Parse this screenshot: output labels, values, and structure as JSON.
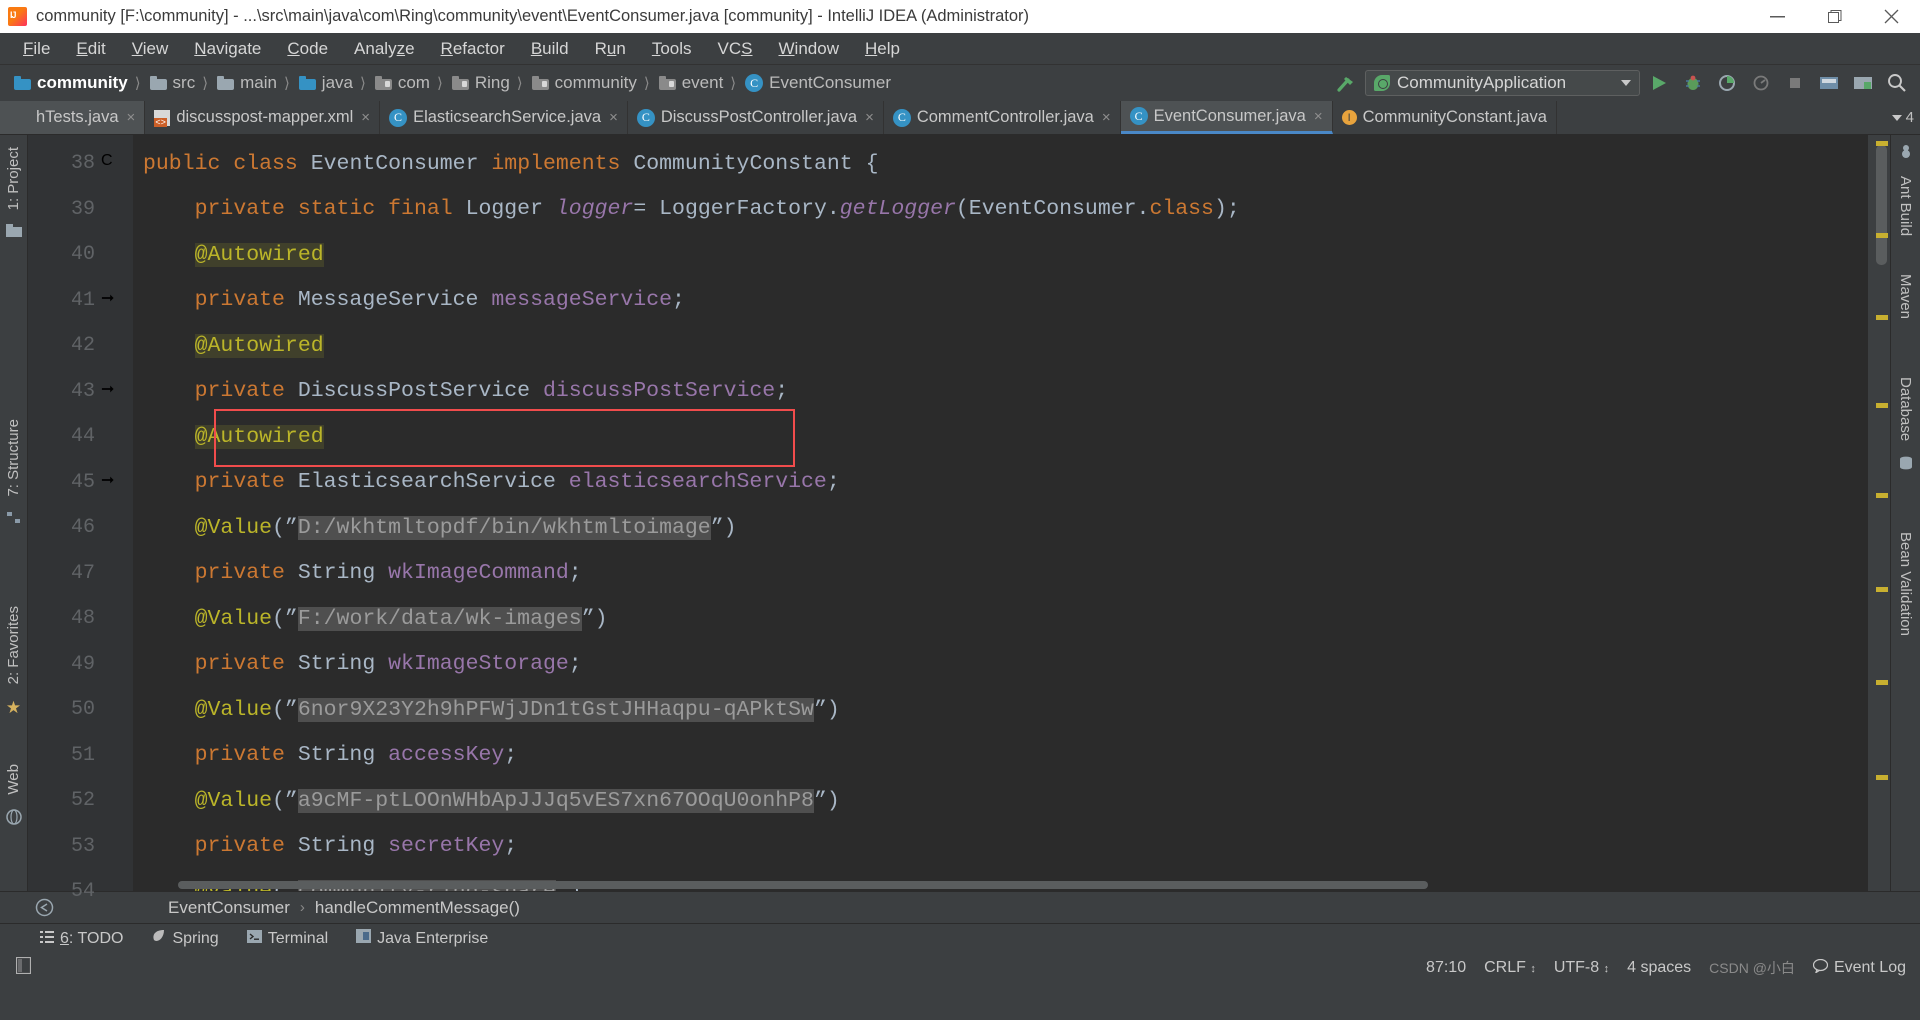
{
  "window": {
    "title": "community [F:\\community] - ...\\src\\main\\java\\com\\Ring\\community\\event\\EventConsumer.java [community] - IntelliJ IDEA (Administrator)",
    "logo_icon": "intellij-idea-logo-icon",
    "minimize_icon": "minimize-icon",
    "maximize_icon": "maximize-restore-icon",
    "close_icon": "close-icon"
  },
  "menu": [
    {
      "label": "File",
      "mnemonic": "F"
    },
    {
      "label": "Edit",
      "mnemonic": "E"
    },
    {
      "label": "View",
      "mnemonic": "V"
    },
    {
      "label": "Navigate",
      "mnemonic": "N"
    },
    {
      "label": "Code",
      "mnemonic": "C"
    },
    {
      "label": "Analyze",
      "mnemonic": "z"
    },
    {
      "label": "Refactor",
      "mnemonic": "R"
    },
    {
      "label": "Build",
      "mnemonic": "B"
    },
    {
      "label": "Run",
      "mnemonic": "u"
    },
    {
      "label": "Tools",
      "mnemonic": "T"
    },
    {
      "label": "VCS",
      "mnemonic": "S"
    },
    {
      "label": "Window",
      "mnemonic": "W"
    },
    {
      "label": "Help",
      "mnemonic": "H"
    }
  ],
  "breadcrumbs": [
    {
      "label": "community",
      "icon": "module-folder-icon"
    },
    {
      "label": "src",
      "icon": "folder-icon"
    },
    {
      "label": "main",
      "icon": "folder-icon"
    },
    {
      "label": "java",
      "icon": "source-root-folder-icon"
    },
    {
      "label": "com",
      "icon": "package-icon"
    },
    {
      "label": "Ring",
      "icon": "package-icon"
    },
    {
      "label": "community",
      "icon": "package-icon"
    },
    {
      "label": "event",
      "icon": "package-icon"
    },
    {
      "label": "EventConsumer",
      "icon": "java-class-icon"
    }
  ],
  "toolbar": {
    "run_config": "CommunityApplication",
    "run_config_icon": "spring-boot-leaf-icon",
    "dropdown_icon": "chevron-down-icon",
    "build_icon": "build-hammer-icon",
    "run_icon": "run-play-icon",
    "debug_icon": "debug-bug-icon",
    "run_with_coverage_icon": "run-coverage-icon",
    "profile_icon": "profiler-icon",
    "stop_icon": "stop-icon",
    "update_app_icon": "update-running-application-icon",
    "settings_icon": "settings-gear-icon",
    "search_icon": "search-everywhere-icon"
  },
  "tabs": [
    {
      "label": "hTests.java",
      "icon": "java-class-icon",
      "state": "partial",
      "close": "×"
    },
    {
      "label": "discusspost-mapper.xml",
      "icon": "xml-file-icon",
      "state": "normal",
      "close": "×"
    },
    {
      "label": "ElasticsearchService.java",
      "icon": "java-class-icon",
      "state": "normal",
      "close": "×"
    },
    {
      "label": "DiscussPostController.java",
      "icon": "java-class-icon",
      "state": "normal",
      "close": "×"
    },
    {
      "label": "CommentController.java",
      "icon": "java-class-icon",
      "state": "normal",
      "close": "×"
    },
    {
      "label": "EventConsumer.java",
      "icon": "java-class-icon",
      "state": "active",
      "close": "×"
    },
    {
      "label": "CommunityConstant.java",
      "icon": "java-interface-icon",
      "state": "normal",
      "close": ""
    }
  ],
  "tabs_overflow": {
    "label": "4",
    "icon": "chevron-down-icon"
  },
  "left_toolwindows": [
    {
      "label": "1: Project",
      "icon": "project-icon"
    },
    {
      "label": "7: Structure",
      "icon": "structure-icon"
    },
    {
      "label": "2: Favorites",
      "icon": "favorites-star-icon"
    },
    {
      "label": "Web",
      "icon": "web-icon"
    }
  ],
  "right_toolwindows": [
    {
      "label": "Ant Build",
      "icon": "ant-icon"
    },
    {
      "label": "Maven",
      "icon": "maven-m-icon"
    },
    {
      "label": "Database",
      "icon": "database-icon"
    },
    {
      "label": "Bean Validation",
      "icon": "bean-validation-icon"
    }
  ],
  "editor": {
    "first_line_number": 38,
    "lines": [
      {
        "num": 38,
        "gutter": "spring-bean-class-icon",
        "tokens": [
          {
            "t": "public ",
            "c": "kw"
          },
          {
            "t": "class ",
            "c": "kw"
          },
          {
            "t": "EventConsumer ",
            "c": "cls"
          },
          {
            "t": "implements ",
            "c": "kw"
          },
          {
            "t": "CommunityConstant ",
            "c": "cls"
          },
          {
            "t": "{",
            "c": "plain"
          }
        ],
        "indent": 0
      },
      {
        "num": 39,
        "gutter": "",
        "tokens": [
          {
            "t": "    ",
            "c": "plain"
          },
          {
            "t": "private ",
            "c": "kw"
          },
          {
            "t": "static ",
            "c": "kw"
          },
          {
            "t": "final ",
            "c": "kw"
          },
          {
            "t": "Logger ",
            "c": "cls"
          },
          {
            "t": "logger",
            "c": "it"
          },
          {
            "t": "= ",
            "c": "plain"
          },
          {
            "t": "LoggerFactory.",
            "c": "cls"
          },
          {
            "t": "getLogger",
            "c": "it"
          },
          {
            "t": "(EventConsumer.",
            "c": "cls"
          },
          {
            "t": "class",
            "c": "kw"
          },
          {
            "t": ");",
            "c": "plain"
          }
        ],
        "indent": 1
      },
      {
        "num": 40,
        "gutter": "",
        "tokens": [
          {
            "t": "    ",
            "c": "plain"
          },
          {
            "t": "@Autowired",
            "c": "ann hl-ann"
          }
        ],
        "indent": 1
      },
      {
        "num": 41,
        "gutter": "spring-autowired-icon",
        "tokens": [
          {
            "t": "    ",
            "c": "plain"
          },
          {
            "t": "private ",
            "c": "kw"
          },
          {
            "t": "MessageService ",
            "c": "cls"
          },
          {
            "t": "messageService",
            "c": "fld2"
          },
          {
            "t": ";",
            "c": "plain"
          }
        ],
        "indent": 1
      },
      {
        "num": 42,
        "gutter": "",
        "tokens": [
          {
            "t": "    ",
            "c": "plain"
          },
          {
            "t": "@Autowired",
            "c": "ann hl-ann"
          }
        ],
        "indent": 1
      },
      {
        "num": 43,
        "gutter": "spring-autowired-icon",
        "tokens": [
          {
            "t": "    ",
            "c": "plain"
          },
          {
            "t": "private ",
            "c": "kw"
          },
          {
            "t": "DiscussPostService ",
            "c": "cls"
          },
          {
            "t": "discussPostService",
            "c": "fld2"
          },
          {
            "t": ";",
            "c": "plain"
          }
        ],
        "indent": 1
      },
      {
        "num": 44,
        "gutter": "",
        "tokens": [
          {
            "t": "    ",
            "c": "plain"
          },
          {
            "t": "@Autowired",
            "c": "ann hl-ann"
          }
        ],
        "indent": 1
      },
      {
        "num": 45,
        "gutter": "spring-autowired-icon",
        "tokens": [
          {
            "t": "    ",
            "c": "plain"
          },
          {
            "t": "private ",
            "c": "kw"
          },
          {
            "t": "ElasticsearchService ",
            "c": "cls"
          },
          {
            "t": "elasticsearchService",
            "c": "fld2"
          },
          {
            "t": ";",
            "c": "plain"
          }
        ],
        "indent": 1
      },
      {
        "num": 46,
        "gutter": "",
        "tokens": [
          {
            "t": "    ",
            "c": "plain"
          },
          {
            "t": "@Value",
            "c": "ann"
          },
          {
            "t": "(”",
            "c": "plain"
          },
          {
            "t": "D:/wkhtmltopdf/bin/wkhtmltoimage",
            "c": "hl-str"
          },
          {
            "t": "”)",
            "c": "plain"
          }
        ],
        "indent": 1
      },
      {
        "num": 47,
        "gutter": "",
        "tokens": [
          {
            "t": "    ",
            "c": "plain"
          },
          {
            "t": "private ",
            "c": "kw"
          },
          {
            "t": "String ",
            "c": "cls"
          },
          {
            "t": "wkImageCommand",
            "c": "fld2"
          },
          {
            "t": ";",
            "c": "plain"
          }
        ],
        "indent": 1
      },
      {
        "num": 48,
        "gutter": "",
        "tokens": [
          {
            "t": "    ",
            "c": "plain"
          },
          {
            "t": "@Value",
            "c": "ann"
          },
          {
            "t": "(”",
            "c": "plain"
          },
          {
            "t": "F:/work/data/wk-images",
            "c": "hl-str"
          },
          {
            "t": "”)",
            "c": "plain"
          }
        ],
        "indent": 1
      },
      {
        "num": 49,
        "gutter": "",
        "tokens": [
          {
            "t": "    ",
            "c": "plain"
          },
          {
            "t": "private ",
            "c": "kw"
          },
          {
            "t": "String ",
            "c": "cls"
          },
          {
            "t": "wkImageStorage",
            "c": "fld2"
          },
          {
            "t": ";",
            "c": "plain"
          }
        ],
        "indent": 1
      },
      {
        "num": 50,
        "gutter": "",
        "tokens": [
          {
            "t": "    ",
            "c": "plain"
          },
          {
            "t": "@Value",
            "c": "ann"
          },
          {
            "t": "(”",
            "c": "plain"
          },
          {
            "t": "6nor9X23Y2h9hPFWjJDn1tGstJHHaqpu-qAPktSw",
            "c": "hl-str"
          },
          {
            "t": "”)",
            "c": "plain"
          }
        ],
        "indent": 1
      },
      {
        "num": 51,
        "gutter": "",
        "tokens": [
          {
            "t": "    ",
            "c": "plain"
          },
          {
            "t": "private ",
            "c": "kw"
          },
          {
            "t": "String ",
            "c": "cls"
          },
          {
            "t": "accessKey",
            "c": "fld2"
          },
          {
            "t": ";",
            "c": "plain"
          }
        ],
        "indent": 1
      },
      {
        "num": 52,
        "gutter": "",
        "tokens": [
          {
            "t": "    ",
            "c": "plain"
          },
          {
            "t": "@Value",
            "c": "ann"
          },
          {
            "t": "(”",
            "c": "plain"
          },
          {
            "t": "a9cMF-ptLOOnWHbApJJJq5vES7xn67OOqU0onhP8",
            "c": "hl-str"
          },
          {
            "t": "”)",
            "c": "plain"
          }
        ],
        "indent": 1
      },
      {
        "num": 53,
        "gutter": "",
        "tokens": [
          {
            "t": "    ",
            "c": "plain"
          },
          {
            "t": "private ",
            "c": "kw"
          },
          {
            "t": "String ",
            "c": "cls"
          },
          {
            "t": "secretKey",
            "c": "fld2"
          },
          {
            "t": ";",
            "c": "plain"
          }
        ],
        "indent": 1
      },
      {
        "num": 54,
        "gutter": "",
        "tokens": [
          {
            "t": "    ",
            "c": "plain"
          },
          {
            "t": "@Value",
            "c": "ann"
          },
          {
            "t": "(”",
            "c": "plain"
          },
          {
            "t": "community-ring-share",
            "c": "hl-str"
          },
          {
            "t": "”)",
            "c": "plain"
          }
        ],
        "indent": 1
      }
    ],
    "highlight_box": "red-annotation-box-around-discussPostService"
  },
  "bottom_breadcrumb": {
    "back_icon": "navigate-back-icon",
    "items": [
      "EventConsumer",
      "handleCommentMessage()"
    ],
    "separator": "›"
  },
  "toolwindow_bar": [
    {
      "label": "6: TODO",
      "mnemonic": "6",
      "icon": "todo-list-icon"
    },
    {
      "label": "Spring",
      "icon": "spring-leaf-icon"
    },
    {
      "label": "Terminal",
      "icon": "terminal-icon"
    },
    {
      "label": "Java Enterprise",
      "icon": "java-enterprise-icon"
    }
  ],
  "status_bar": {
    "layout_icon": "toggle-sidebar-icon",
    "caret_position": "87:10",
    "line_separator": "CRLF",
    "encoding": "UTF-8",
    "indent": "4 spaces",
    "event_log": "Event Log",
    "event_log_icon": "event-log-balloon-icon",
    "watermark": "CSDN @小白"
  }
}
